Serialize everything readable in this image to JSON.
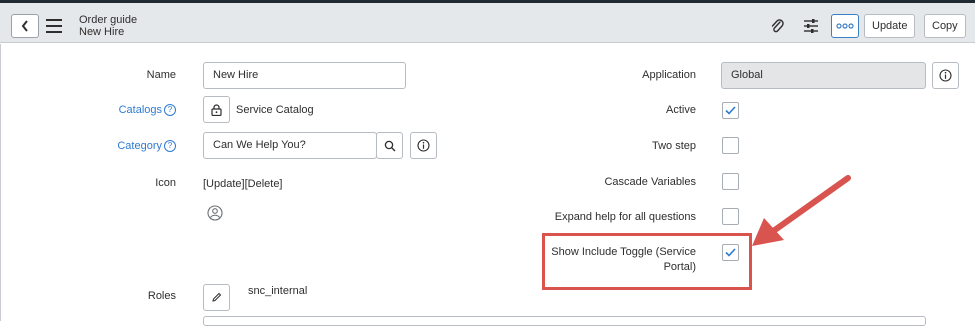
{
  "header": {
    "title": "Order guide",
    "subtitle": "New Hire",
    "update_label": "Update",
    "copy_label": "Copy"
  },
  "form": {
    "name_label": "Name",
    "name_value": "New Hire",
    "catalogs_label": "Catalogs",
    "catalogs_value": "Service Catalog",
    "category_label": "Category",
    "category_value": "Can We Help You?",
    "icon_label": "Icon",
    "icon_links": "[Update][Delete]",
    "roles_label": "Roles",
    "roles_value": "snc_internal",
    "application_label": "Application",
    "application_value": "Global",
    "active_label": "Active",
    "two_step_label": "Two step",
    "cascade_label": "Cascade Variables",
    "expand_help_label": "Expand help for all questions",
    "show_toggle_label_1": "Show Include Toggle (Service",
    "show_toggle_label_2": "Portal)"
  },
  "checkboxes": {
    "active": true,
    "two_step": false,
    "cascade_variables": false,
    "expand_help": false,
    "show_include_toggle": true
  },
  "colors": {
    "link": "#2f7bd1",
    "highlight": "#d9534f",
    "header_bg": "#e5e8ea"
  }
}
